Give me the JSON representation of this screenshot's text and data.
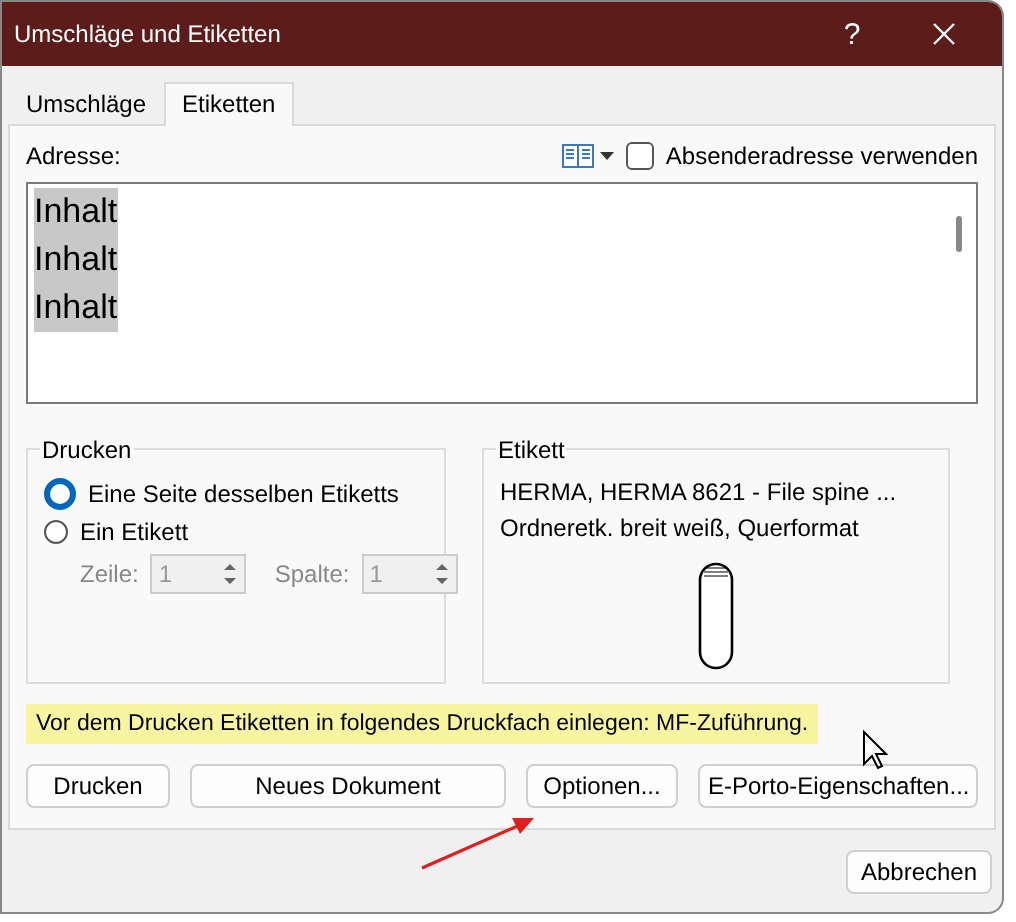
{
  "window": {
    "title": "Umschläge und Etiketten",
    "help": "?"
  },
  "tabs": [
    {
      "label": "Umschläge",
      "selected": false
    },
    {
      "label": "Etiketten",
      "selected": true
    }
  ],
  "address": {
    "label": "Adresse:",
    "lines": [
      "Inhalt",
      "Inhalt",
      "Inhalt"
    ],
    "selected": true,
    "use_sender": {
      "label": "Absenderadresse verwenden",
      "checked": false
    }
  },
  "print_group": {
    "title": "Drucken",
    "options": [
      {
        "label": "Eine Seite desselben Etiketts",
        "selected": true
      },
      {
        "label": "Ein Etikett",
        "selected": false
      }
    ],
    "row": {
      "label": "Zeile:",
      "value": "1"
    },
    "column": {
      "label": "Spalte:",
      "value": "1"
    }
  },
  "label_group": {
    "title": "Etikett",
    "lines": [
      "HERMA, HERMA 8621 - File spine ...",
      "Ordneretk. breit weiß, Querformat"
    ]
  },
  "note": "Vor dem Drucken Etiketten in folgendes Druckfach einlegen: MF-Zuführung.",
  "buttons": [
    "Drucken",
    "Neues Dokument",
    "Optionen...",
    "E-Porto-Eigenschaften..."
  ],
  "cancel": "Abbrechen"
}
